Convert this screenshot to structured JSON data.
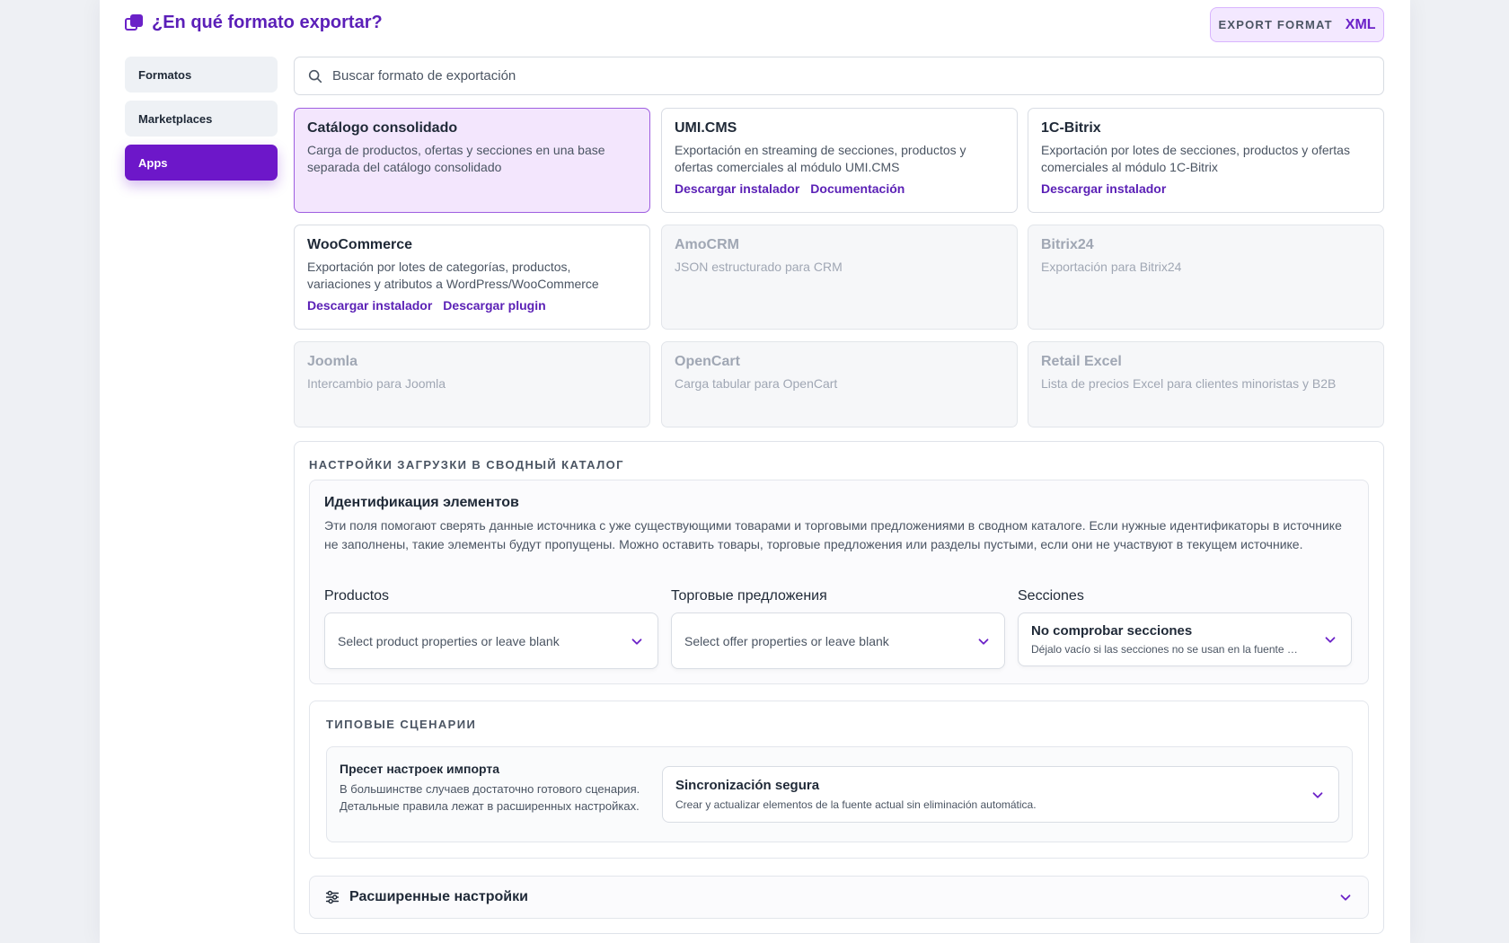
{
  "header": {
    "title": "¿En qué formato exportar?",
    "export_label": "EXPORT FORMAT",
    "export_value": "XML"
  },
  "sidebar": {
    "items": [
      {
        "label": "Formatos",
        "active": false
      },
      {
        "label": "Marketplaces",
        "active": false
      },
      {
        "label": "Apps",
        "active": true
      }
    ]
  },
  "search": {
    "placeholder": "Buscar formato de exportación"
  },
  "cards": [
    {
      "title": "Catálogo consolidado",
      "desc": "Carga de productos, ofertas y secciones en una base separada del catálogo consolidado",
      "links": [],
      "state": "selected"
    },
    {
      "title": "UMI.CMS",
      "desc": "Exportación en streaming de secciones, productos y ofertas comerciales al módulo UMI.CMS",
      "links": [
        "Descargar instalador",
        "Documentación"
      ],
      "state": "normal"
    },
    {
      "title": "1C-Bitrix",
      "desc": "Exportación por lotes de secciones, productos y ofertas comerciales al módulo 1C-Bitrix",
      "links": [
        "Descargar instalador"
      ],
      "state": "normal"
    },
    {
      "title": "WooCommerce",
      "desc": "Exportación por lotes de categorías, productos, variaciones y atributos a WordPress/WooCommerce",
      "links": [
        "Descargar instalador",
        "Descargar plugin"
      ],
      "state": "normal"
    },
    {
      "title": "AmoCRM",
      "desc": "JSON estructurado para CRM",
      "links": [],
      "state": "disabled"
    },
    {
      "title": "Bitrix24",
      "desc": "Exportación para Bitrix24",
      "links": [],
      "state": "disabled"
    },
    {
      "title": "Joomla",
      "desc": "Intercambio para Joomla",
      "links": [],
      "state": "disabled"
    },
    {
      "title": "OpenCart",
      "desc": "Carga tabular para OpenCart",
      "links": [],
      "state": "disabled"
    },
    {
      "title": "Retail Excel",
      "desc": "Lista de precios Excel para clientes minoristas y B2B",
      "links": [],
      "state": "disabled"
    }
  ],
  "settings": {
    "caption": "НАСТРОЙКИ ЗАГРУЗКИ В СВОДНЫЙ КАТАЛОГ",
    "identification": {
      "title": "Идентификация элементов",
      "desc": "Эти поля помогают сверять данные источника с уже существующими товарами и торговыми предложениями в сводном каталоге. Если нужные идентификаторы в источнике не заполнены, такие элементы будут пропущены. Можно оставить товары, торговые предложения или разделы пустыми, если они не участвуют в текущем источнике.",
      "products_label": "Productos",
      "products_placeholder": "Select product properties or leave blank",
      "offers_label": "Торговые предложения",
      "offers_placeholder": "Select offer properties or leave blank",
      "sections_label": "Secciones",
      "sections_value": "No comprobar secciones",
      "sections_hint": "Déjalo vacío si las secciones no se usan en la fuente …"
    },
    "scenarios": {
      "caption": "ТИПОВЫЕ СЦЕНАРИИ",
      "preset_title": "Пресет настроек импорта",
      "preset_desc": "В большинстве случаев достаточно готового сценария. Детальные правила лежат в расширенных настройках.",
      "preset_value": "Sincronización segura",
      "preset_hint": "Crear y actualizar elementos de la fuente actual sin eliminación automática."
    },
    "advanced_label": "Расширенные настройки"
  },
  "colors": {
    "accent": "#6d17c9",
    "accent_text": "#5b21b6"
  }
}
